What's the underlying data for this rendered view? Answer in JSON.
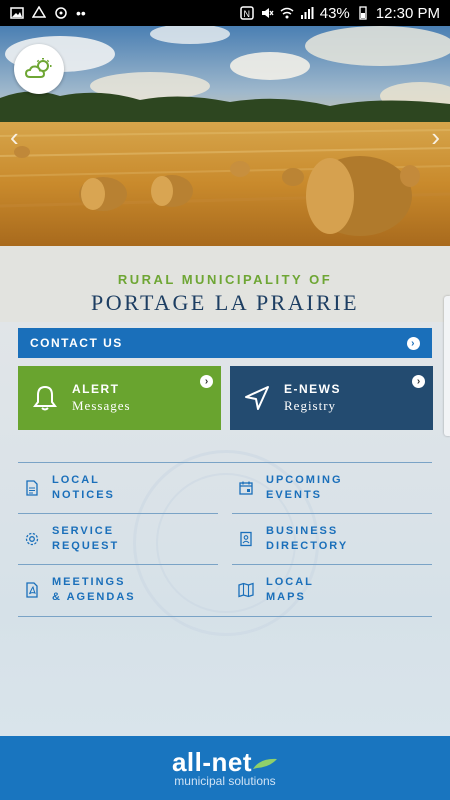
{
  "status_bar": {
    "battery_percent": "43%",
    "time": "12:30 PM",
    "left_icons": [
      "image-icon",
      "drive-icon",
      "sync-icon",
      "more-dots-icon"
    ],
    "right_icons": [
      "nfc-icon",
      "mute-icon",
      "wifi-icon",
      "signal-icon",
      "battery-icon"
    ]
  },
  "hero": {
    "weather_icon": "partly-cloudy-icon",
    "prev_icon": "chevron-left-icon",
    "next_icon": "chevron-right-icon"
  },
  "header": {
    "subtitle": "RURAL MUNICIPALITY OF",
    "title": "PORTAGE LA PRAIRIE"
  },
  "contact": {
    "label": "CONTACT US"
  },
  "tiles": {
    "alert": {
      "line1": "ALERT",
      "line2": "Messages",
      "color": "#69a42f"
    },
    "enews": {
      "line1": "E-NEWS",
      "line2": "Registry",
      "color": "#234b70"
    }
  },
  "menu": [
    {
      "line1": "LOCAL",
      "line2": "NOTICES",
      "icon": "document-icon"
    },
    {
      "line1": "UPCOMING",
      "line2": "EVENTS",
      "icon": "calendar-icon"
    },
    {
      "line1": "SERVICE",
      "line2": "REQUEST",
      "icon": "gear-icon"
    },
    {
      "line1": "BUSINESS",
      "line2": "DIRECTORY",
      "icon": "contact-book-icon"
    },
    {
      "line1": "MEETINGS",
      "line2": "& AGENDAS",
      "icon": "pdf-icon"
    },
    {
      "line1": "LOCAL",
      "line2": "MAPS",
      "icon": "map-icon"
    }
  ],
  "footer": {
    "brand": "all-net",
    "tagline": "municipal solutions"
  },
  "colors": {
    "accent_blue": "#1a6fba",
    "green": "#69a42f",
    "navy": "#234b70"
  }
}
